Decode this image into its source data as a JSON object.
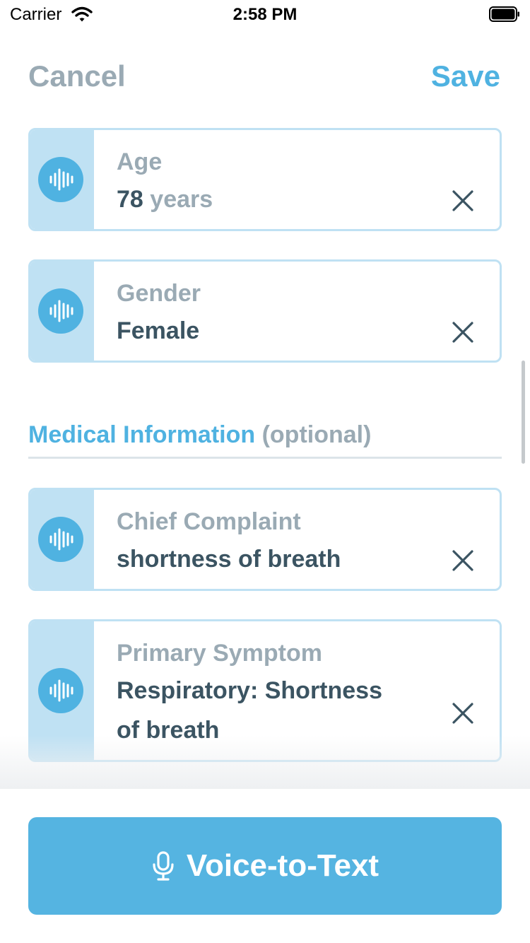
{
  "status_bar": {
    "carrier": "Carrier",
    "time": "2:58 PM"
  },
  "nav": {
    "cancel": "Cancel",
    "save": "Save"
  },
  "fields": [
    {
      "label": "Age",
      "value": "78",
      "unit": "years"
    },
    {
      "label": "Gender",
      "value": "Female"
    },
    {
      "label": "Chief Complaint",
      "value": "shortness of breath"
    },
    {
      "label": "Primary Symptom",
      "value_line1": "Respiratory: Shortness",
      "value_line2": "of breath"
    }
  ],
  "section": {
    "title": "Medical Information",
    "optional": "(optional)"
  },
  "primary_button": {
    "label": "Voice-to-Text"
  },
  "colors": {
    "accent": "#4fb2e1",
    "field_border": "#bfe1f3",
    "label_gray": "#9aaab4",
    "value_text": "#3b5462"
  }
}
